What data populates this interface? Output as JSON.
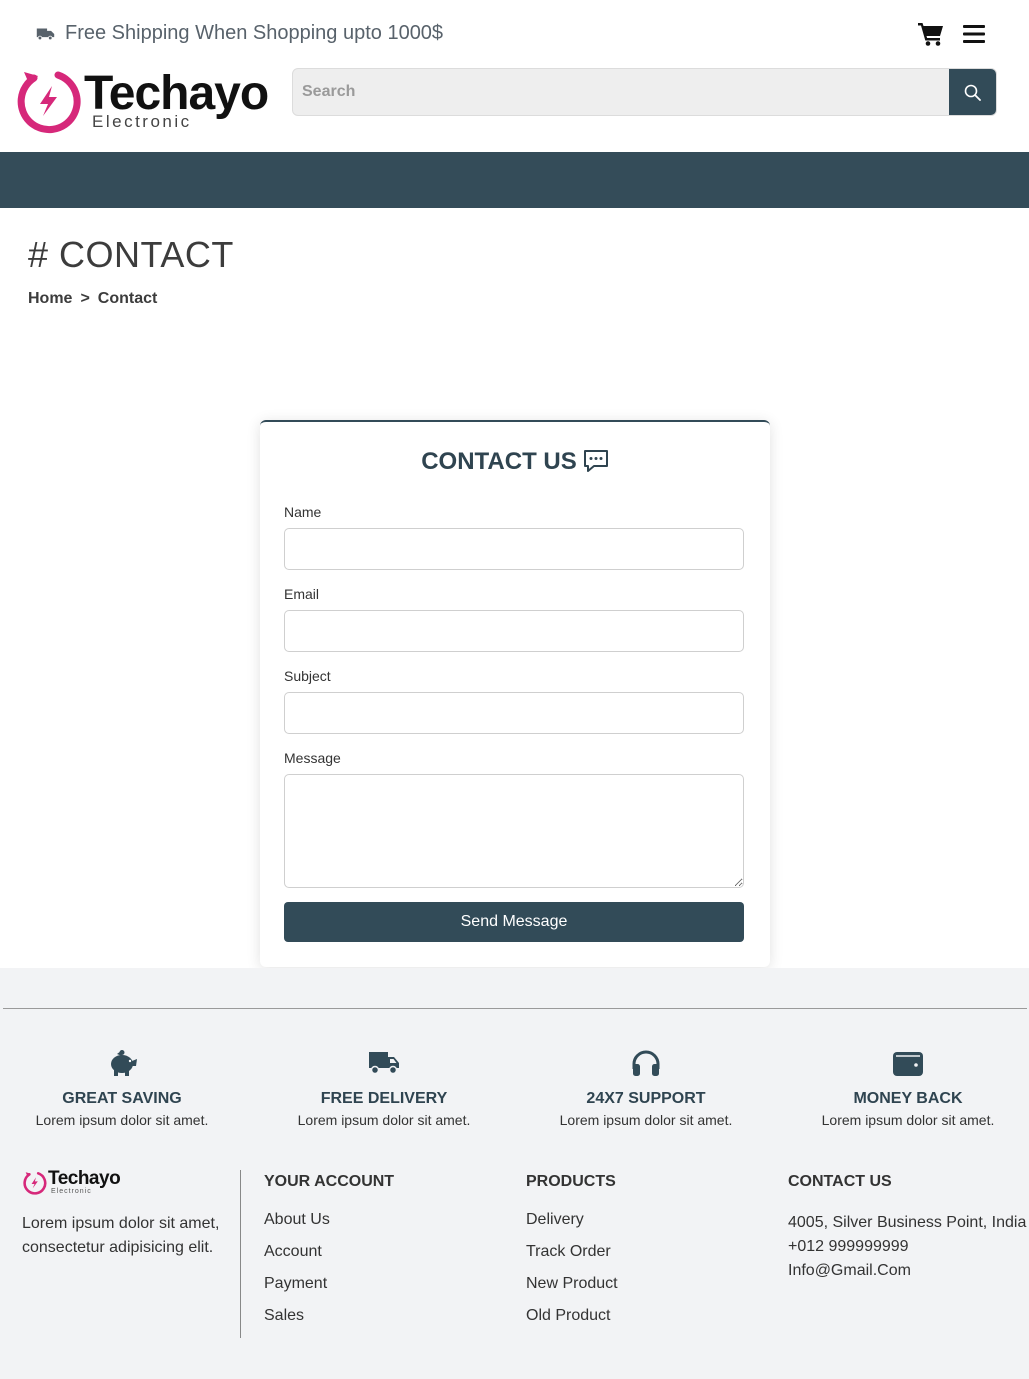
{
  "topbar": {
    "shipping_text": "Free Shipping When Shopping upto 1000$"
  },
  "logo": {
    "brand": "Techayo",
    "tagline": "Electronic"
  },
  "search": {
    "placeholder": "Search"
  },
  "page": {
    "title": "# CONTACT",
    "breadcrumb": {
      "home": "Home",
      "separator": ">",
      "current": "Contact"
    }
  },
  "contact_form": {
    "title": "CONTACT US",
    "name_label": "Name",
    "email_label": "Email",
    "subject_label": "Subject",
    "message_label": "Message",
    "submit_label": "Send Message"
  },
  "features": [
    {
      "icon": "piggy-bank-icon",
      "title": "GREAT SAVING",
      "desc": "Lorem ipsum dolor sit amet."
    },
    {
      "icon": "truck-icon",
      "title": "FREE DELIVERY",
      "desc": "Lorem ipsum dolor sit amet."
    },
    {
      "icon": "headset-icon",
      "title": "24X7 SUPPORT",
      "desc": "Lorem ipsum dolor sit amet."
    },
    {
      "icon": "wallet-icon",
      "title": "MONEY BACK",
      "desc": "Lorem ipsum dolor sit amet."
    }
  ],
  "footer": {
    "brand": "Techayo",
    "tagline": "Electronic",
    "description": "Lorem ipsum dolor sit amet, consectetur adipisicing elit.",
    "account": {
      "heading": "YOUR ACCOUNT",
      "links": [
        "About Us",
        "Account",
        "Payment",
        "Sales"
      ]
    },
    "products": {
      "heading": "PRODUCTS",
      "links": [
        "Delivery",
        "Track Order",
        "New Product",
        "Old Product"
      ]
    },
    "contact": {
      "heading": "CONTACT US",
      "address": "4005, Silver Business Point, India",
      "phone": "+012 999999999",
      "email": "Info@Gmail.Com"
    }
  },
  "colors": {
    "primary": "#324b58",
    "brand_accent": "#d6287a",
    "footer_bg": "#f2f3f5"
  }
}
